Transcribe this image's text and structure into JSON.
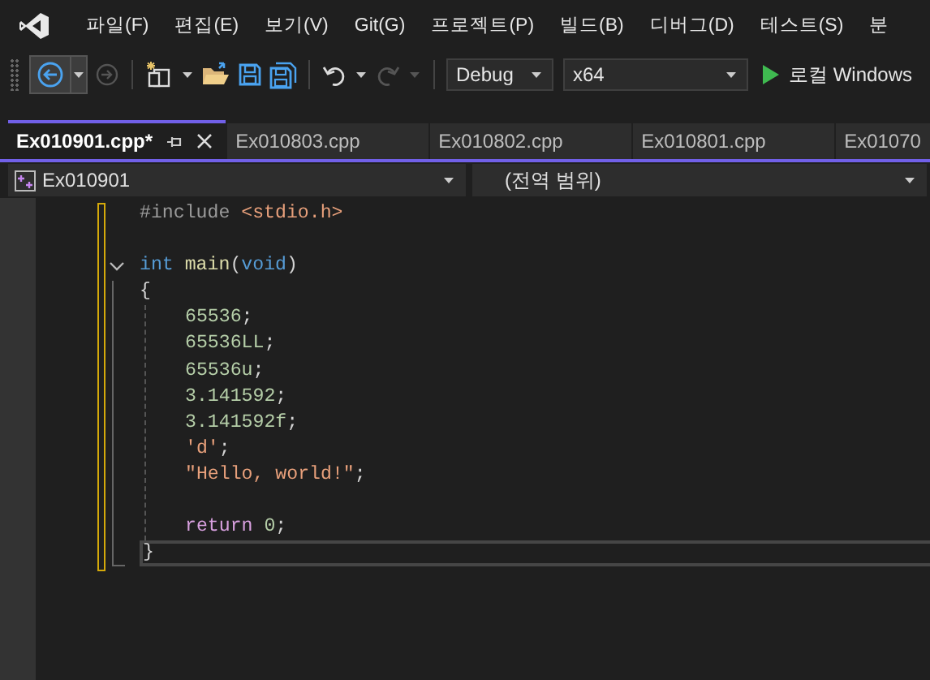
{
  "menu": [
    {
      "label": "파일(F)"
    },
    {
      "label": "편집(E)"
    },
    {
      "label": "보기(V)"
    },
    {
      "label": "Git(G)"
    },
    {
      "label": "프로젝트(P)"
    },
    {
      "label": "빌드(B)"
    },
    {
      "label": "디버그(D)"
    },
    {
      "label": "테스트(S)"
    },
    {
      "label": "분"
    }
  ],
  "toolbar": {
    "configuration": "Debug",
    "platform": "x64",
    "run_label": "로컬 Windows"
  },
  "tabs": [
    {
      "label": "Ex010901.cpp*",
      "selected": true
    },
    {
      "label": "Ex010803.cpp",
      "selected": false
    },
    {
      "label": "Ex010802.cpp",
      "selected": false
    },
    {
      "label": "Ex010801.cpp",
      "selected": false
    },
    {
      "label": "Ex01070",
      "selected": false
    }
  ],
  "navbar": {
    "project": "Ex010901",
    "scope": "(전역 범위)"
  },
  "code": [
    {
      "current": false,
      "tokens": [
        {
          "kind": "preproc",
          "text": "#include "
        },
        {
          "kind": "string",
          "text": "<stdio.h>"
        }
      ]
    },
    {
      "current": false
    },
    {
      "current": false,
      "expanded": true,
      "tokens": [
        {
          "kind": "keyword",
          "text": "int "
        },
        {
          "kind": "function",
          "text": "main"
        },
        {
          "kind": "plain",
          "text": "("
        },
        {
          "kind": "keyword",
          "text": "void"
        },
        {
          "kind": "plain",
          "text": ")"
        }
      ],
      "body": [
        {
          "current": false,
          "tokens": [
            {
              "kind": "plain",
              "text": "{"
            }
          ],
          "children": [
            {
              "current": false,
              "tokens": [
                {
                  "kind": "number",
                  "text": "65536"
                },
                {
                  "kind": "plain",
                  "text": ";"
                }
              ]
            },
            {
              "current": false,
              "tokens": [
                {
                  "kind": "number",
                  "text": "65536LL"
                },
                {
                  "kind": "plain",
                  "text": ";"
                }
              ]
            },
            {
              "current": false,
              "tokens": [
                {
                  "kind": "number",
                  "text": "65536u"
                },
                {
                  "kind": "plain",
                  "text": ";"
                }
              ]
            },
            {
              "current": false,
              "tokens": [
                {
                  "kind": "number",
                  "text": "3.141592"
                },
                {
                  "kind": "plain",
                  "text": ";"
                }
              ]
            },
            {
              "current": false,
              "tokens": [
                {
                  "kind": "number",
                  "text": "3.141592f"
                },
                {
                  "kind": "plain",
                  "text": ";"
                }
              ]
            },
            {
              "current": false,
              "tokens": [
                {
                  "kind": "string",
                  "text": "'d'"
                },
                {
                  "kind": "plain",
                  "text": ";"
                }
              ]
            },
            {
              "current": false,
              "tokens": [
                {
                  "kind": "string",
                  "text": "\"Hello, world!\""
                },
                {
                  "kind": "plain",
                  "text": ";"
                }
              ]
            },
            {
              "current": false
            },
            {
              "current": false,
              "tokens": [
                {
                  "kind": "control",
                  "text": "return "
                },
                {
                  "kind": "number",
                  "text": "0"
                },
                {
                  "kind": "plain",
                  "text": ";"
                }
              ]
            }
          ]
        },
        {
          "current": true,
          "tokens": [
            {
              "kind": "plain",
              "text": "}"
            }
          ]
        }
      ]
    }
  ]
}
